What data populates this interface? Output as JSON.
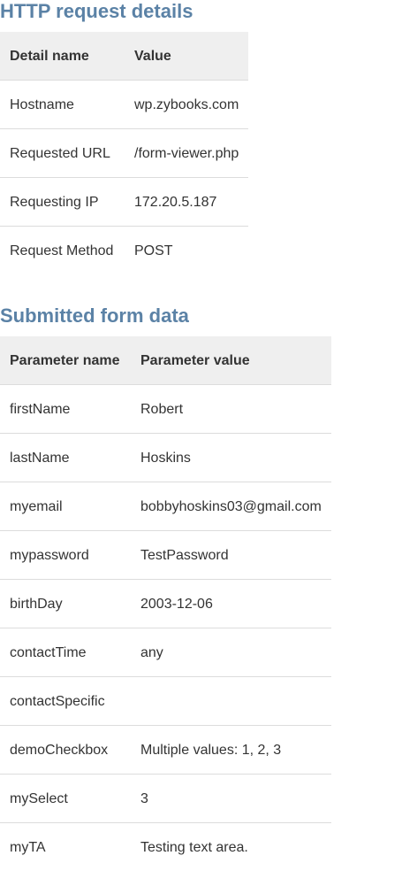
{
  "http_section": {
    "title": "HTTP request details",
    "headers": [
      "Detail name",
      "Value"
    ],
    "rows": [
      [
        "Hostname",
        "wp.zybooks.com"
      ],
      [
        "Requested URL",
        "/form-viewer.php"
      ],
      [
        "Requesting IP",
        "172.20.5.187"
      ],
      [
        "Request Method",
        "POST"
      ]
    ]
  },
  "form_section": {
    "title": "Submitted form data",
    "headers": [
      "Parameter name",
      "Parameter value"
    ],
    "rows": [
      [
        "firstName",
        "Robert"
      ],
      [
        "lastName",
        "Hoskins"
      ],
      [
        "myemail",
        "bobbyhoskins03@gmail.com"
      ],
      [
        "mypassword",
        "TestPassword"
      ],
      [
        "birthDay",
        "2003-12-06"
      ],
      [
        "contactTime",
        "any"
      ],
      [
        "contactSpecific",
        ""
      ],
      [
        "demoCheckbox",
        "Multiple values: 1, 2, 3"
      ],
      [
        "mySelect",
        "3"
      ],
      [
        "myTA",
        "Testing text area."
      ]
    ]
  },
  "colors": {
    "heading": "#5b82a6",
    "header_bg": "#efefef",
    "row_border": "#dcdcdc",
    "text": "#333333"
  }
}
